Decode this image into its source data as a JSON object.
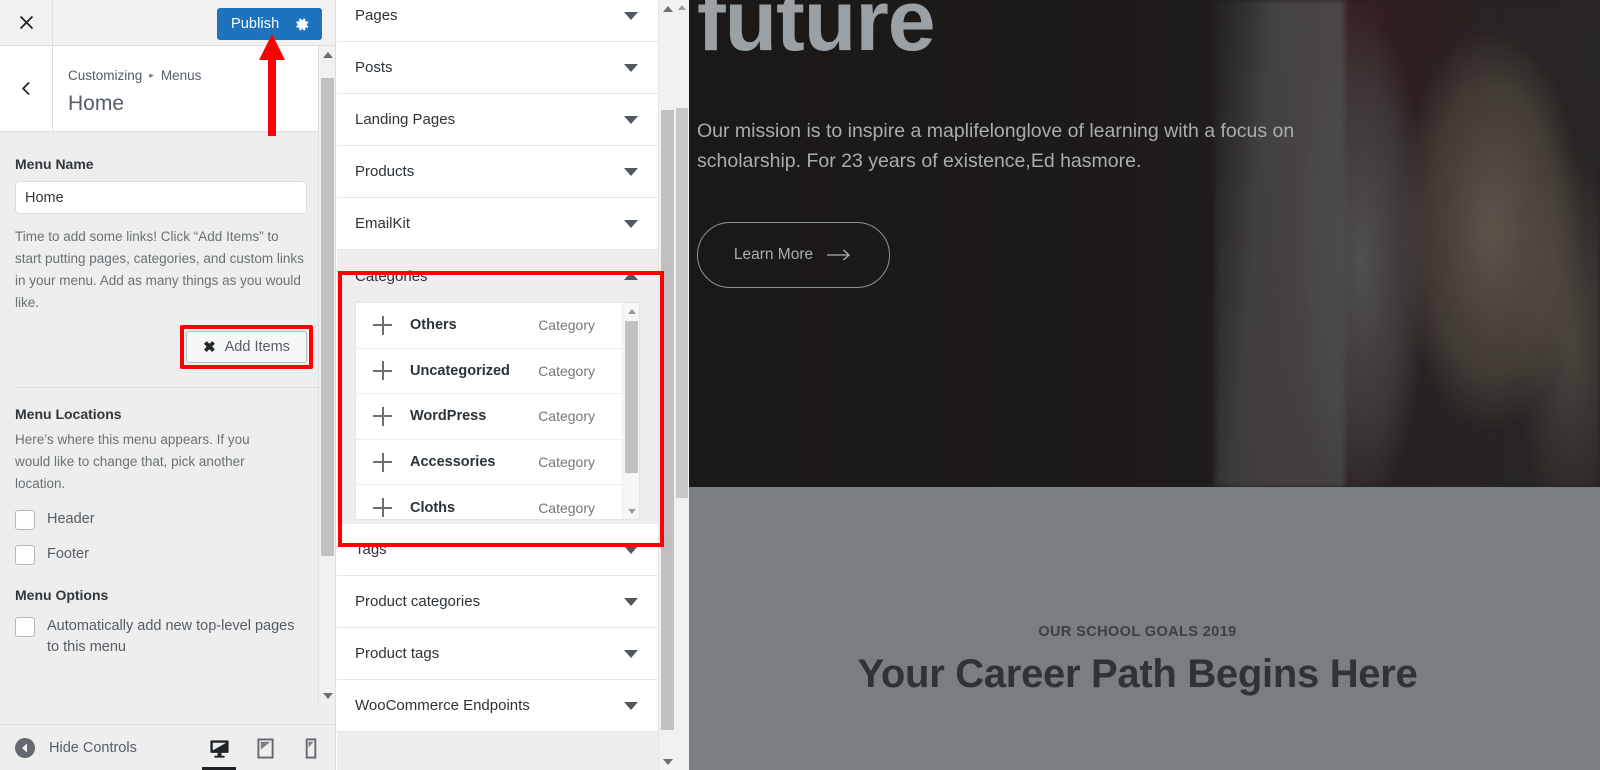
{
  "customizer": {
    "close_icon": "close-x-icon",
    "publish_label": "Publish",
    "publish_gear_icon": "gear-icon",
    "back_icon": "chevron-left-icon",
    "breadcrumb_root": "Customizing",
    "breadcrumb_sep": "▸",
    "breadcrumb_current": "Menus",
    "panel_title": "Home",
    "accent_blue": "#1e73be",
    "highlight_red": "#ff0000"
  },
  "menu_panel": {
    "menu_name_label": "Menu Name",
    "menu_name_value": "Home",
    "menu_name_placeholder": "Menu Name",
    "description": "Time to add some links! Click “Add Items” to start putting pages, categories, and custom links in your menu. Add as many things as you would like.",
    "add_items_label": "Add Items",
    "add_items_icon": "close-x-icon",
    "locations_heading": "Menu Locations",
    "locations_description": "Here’s where this menu appears. If you would like to change that, pick another location.",
    "locations": [
      {
        "label": "Header",
        "checked": false
      },
      {
        "label": "Footer",
        "checked": false
      }
    ],
    "options_heading": "Menu Options",
    "options": [
      {
        "label": "Automatically add new top-level pages to this menu",
        "checked": false
      }
    ]
  },
  "footer": {
    "hide_controls_label": "Hide Controls",
    "hide_controls_icon": "collapse-left-icon",
    "devices": [
      {
        "name": "desktop",
        "icon": "desktop-icon",
        "active": true
      },
      {
        "name": "tablet",
        "icon": "tablet-icon",
        "active": false
      },
      {
        "name": "mobile",
        "icon": "mobile-icon",
        "active": false
      }
    ]
  },
  "add_menu_items": {
    "sections_top": [
      {
        "label": "Pages",
        "expanded": false
      },
      {
        "label": "Posts",
        "expanded": false
      },
      {
        "label": "Landing Pages",
        "expanded": false
      },
      {
        "label": "Products",
        "expanded": false
      },
      {
        "label": "EmailKit",
        "expanded": false
      }
    ],
    "expanded_section": {
      "label": "Categories",
      "expanded": true,
      "items": [
        {
          "name": "Others",
          "type": "Category",
          "add_icon": "plus-icon"
        },
        {
          "name": "Uncategorized",
          "type": "Category",
          "add_icon": "plus-icon"
        },
        {
          "name": "WordPress",
          "type": "Category",
          "add_icon": "plus-icon"
        },
        {
          "name": "Accessories",
          "type": "Category",
          "add_icon": "plus-icon"
        },
        {
          "name": "Cloths",
          "type": "Category",
          "add_icon": "plus-icon"
        }
      ]
    },
    "sections_bottom": [
      {
        "label": "Tags",
        "expanded": false
      },
      {
        "label": "Product categories",
        "expanded": false
      },
      {
        "label": "Product tags",
        "expanded": false
      },
      {
        "label": "WooCommerce Endpoints",
        "expanded": false
      }
    ]
  },
  "preview": {
    "hero_title": "future",
    "hero_subtitle": "Our mission is to inspire a maplifelonglove of learning with a focus on scholarship. For 23 years of existence,Ed hasmore.",
    "hero_button_label": "Learn More",
    "hero_button_icon": "arrow-right-icon",
    "goals_eyebrow": "OUR SCHOOL GOALS 2019",
    "goals_title": "Your Career Path Begins Here",
    "band_color": "#787e82"
  }
}
